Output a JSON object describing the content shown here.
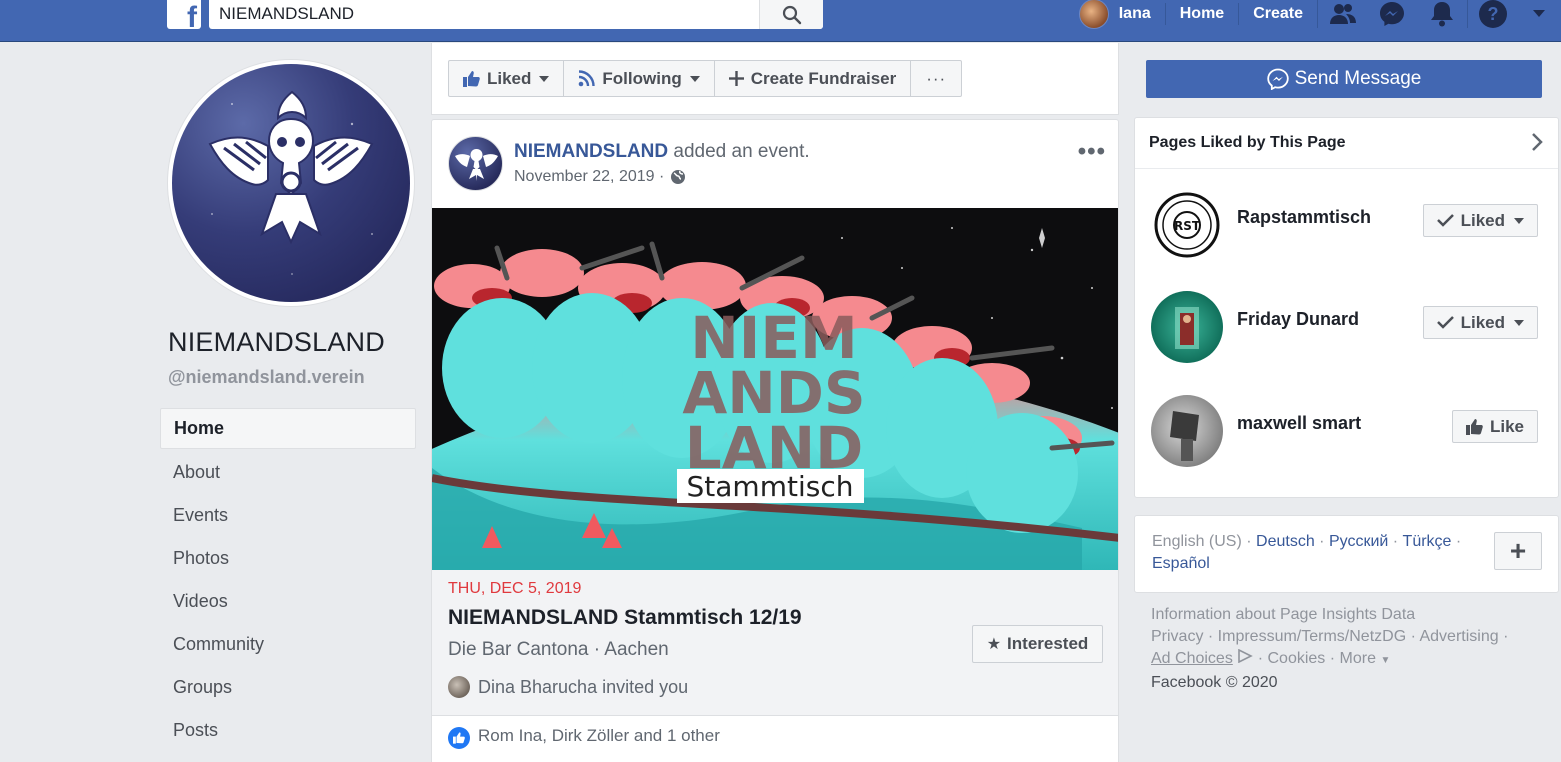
{
  "topbar": {
    "search_value": "NIEMANDSLAND",
    "user_name": "Iana",
    "home": "Home",
    "create": "Create"
  },
  "page": {
    "name": "NIEMANDSLAND",
    "handle": "@niemandsland.verein"
  },
  "leftnav": [
    "Home",
    "About",
    "Events",
    "Photos",
    "Videos",
    "Community",
    "Groups",
    "Posts"
  ],
  "actions": {
    "liked": "Liked",
    "following": "Following",
    "fundraiser": "Create Fundraiser",
    "more": "···",
    "send_message": "Send Message"
  },
  "post": {
    "author": "NIEMANDSLAND",
    "action": " added an event.",
    "date": "November 22, 2019 ·",
    "image_title_lines": [
      "NIEM",
      "ANDS",
      "LAND"
    ],
    "image_subtitle": "Stammtisch",
    "event_date": "THU, DEC 5, 2019",
    "event_title": "NIEMANDSLAND Stammtisch 12/19",
    "event_location": "Die Bar Cantona · Aachen",
    "invite_text": "Dina Bharucha invited you",
    "interested": "Interested",
    "likes_text": "Rom Ina, Dirk Zöller and 1 other"
  },
  "pages_liked": {
    "title": "Pages Liked by This Page",
    "items": [
      {
        "name": "Rapstammtisch",
        "button": "Liked"
      },
      {
        "name": "Friday Dunard",
        "button": "Liked"
      },
      {
        "name": "maxwell smart",
        "button": "Like"
      }
    ]
  },
  "languages": {
    "current": "English (US)",
    "others": [
      "Deutsch",
      "Русский",
      "Türkçe",
      "Español"
    ]
  },
  "footer": {
    "line1": "Information about Page Insights Data",
    "privacy": "Privacy",
    "impressum": "Impressum/Terms/NetzDG",
    "advertising": "Advertising",
    "ad_choices": "Ad Choices",
    "cookies": "Cookies",
    "more": "More",
    "copyright": "Facebook © 2020"
  },
  "colors": {
    "brand_blue": "#4267b2",
    "link": "#385898",
    "event_date_red": "#e0393e"
  }
}
